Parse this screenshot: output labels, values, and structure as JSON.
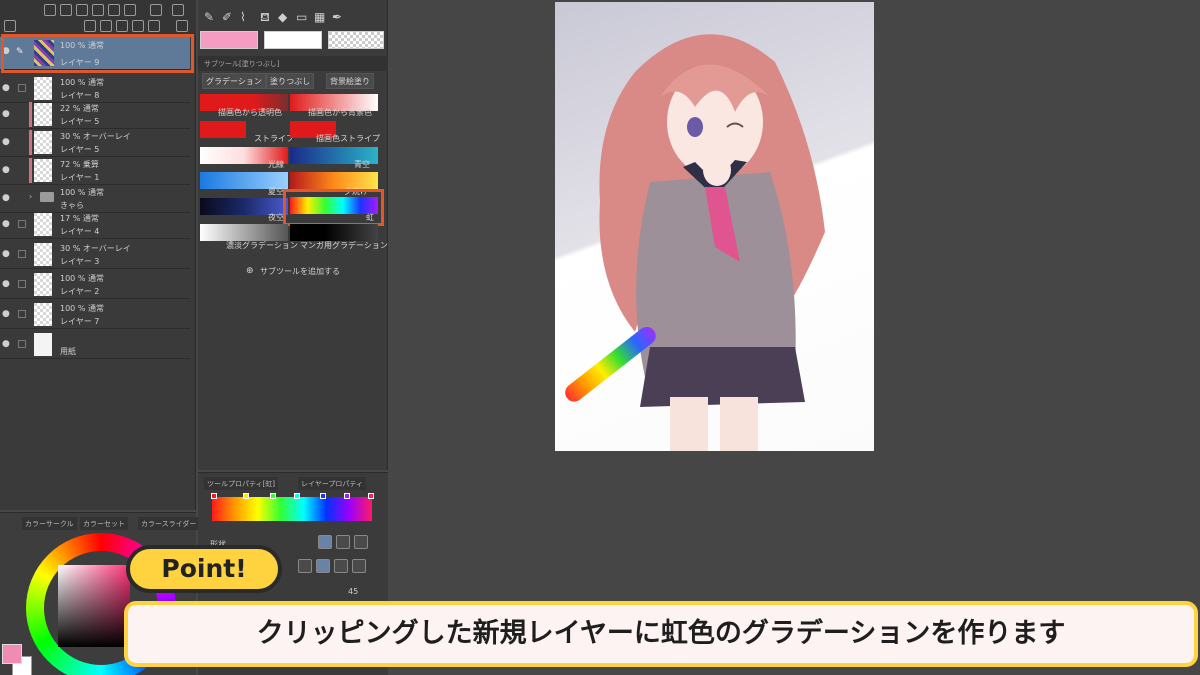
{
  "layers": [
    {
      "mode": "100 % 通常",
      "name": "レイヤー 9",
      "selected": true
    },
    {
      "mode": "100 % 通常",
      "name": "レイヤー 8"
    },
    {
      "mode": "22 % 通常",
      "name": "レイヤー 5"
    },
    {
      "mode": "30 % オーバーレイ",
      "name": "レイヤー 5"
    },
    {
      "mode": "72 % 乗算",
      "name": "レイヤー 1"
    },
    {
      "mode": "100 % 通常",
      "name": "きゃら",
      "folder": true
    },
    {
      "mode": "17 % 通常",
      "name": "レイヤー 4"
    },
    {
      "mode": "30 % オーバーレイ",
      "name": "レイヤー 3"
    },
    {
      "mode": "100 % 通常",
      "name": "レイヤー 2"
    },
    {
      "mode": "100 % 通常",
      "name": "レイヤー 7"
    },
    {
      "mode": "",
      "name": "用紙"
    }
  ],
  "color_panel": {
    "tabs": [
      "カラーサークル",
      "カラーセット",
      "カラースライダー"
    ],
    "main_color": "#f08cb4",
    "sub_color": "#ffffff"
  },
  "subtool": {
    "header": "サブツール[塗りつぶし]",
    "tabs": [
      "グラデーション",
      "塗りつぶし",
      "背景絵塗り"
    ],
    "gradients": [
      {
        "label": "描画色から透明色"
      },
      {
        "label": "描画色から背景色"
      },
      {
        "label": "ストライプ"
      },
      {
        "label": "描画色ストライプ"
      },
      {
        "label": "光線"
      },
      {
        "label": "青空"
      },
      {
        "label": "夏空"
      },
      {
        "label": "夕焼け"
      },
      {
        "label": "夜空"
      },
      {
        "label": "虹"
      },
      {
        "label": "濃淡グラデーション"
      },
      {
        "label": "マンガ用グラデーション"
      }
    ],
    "add_label": "サブツールを追加する",
    "colors": {
      "main": "#f59cc3",
      "sub": "#ffffff"
    }
  },
  "tool_property": {
    "tabs": [
      "ツールプロパティ[虹]",
      "レイヤープロパティ"
    ],
    "shape_label": "形状",
    "angle_value": "45"
  },
  "overlay": {
    "point": "Point!",
    "caption": "クリッピングした新規レイヤーに虹色のグラデーションを作ります"
  },
  "accent_color": "#e2572a",
  "badge_color": "#ffd23f"
}
